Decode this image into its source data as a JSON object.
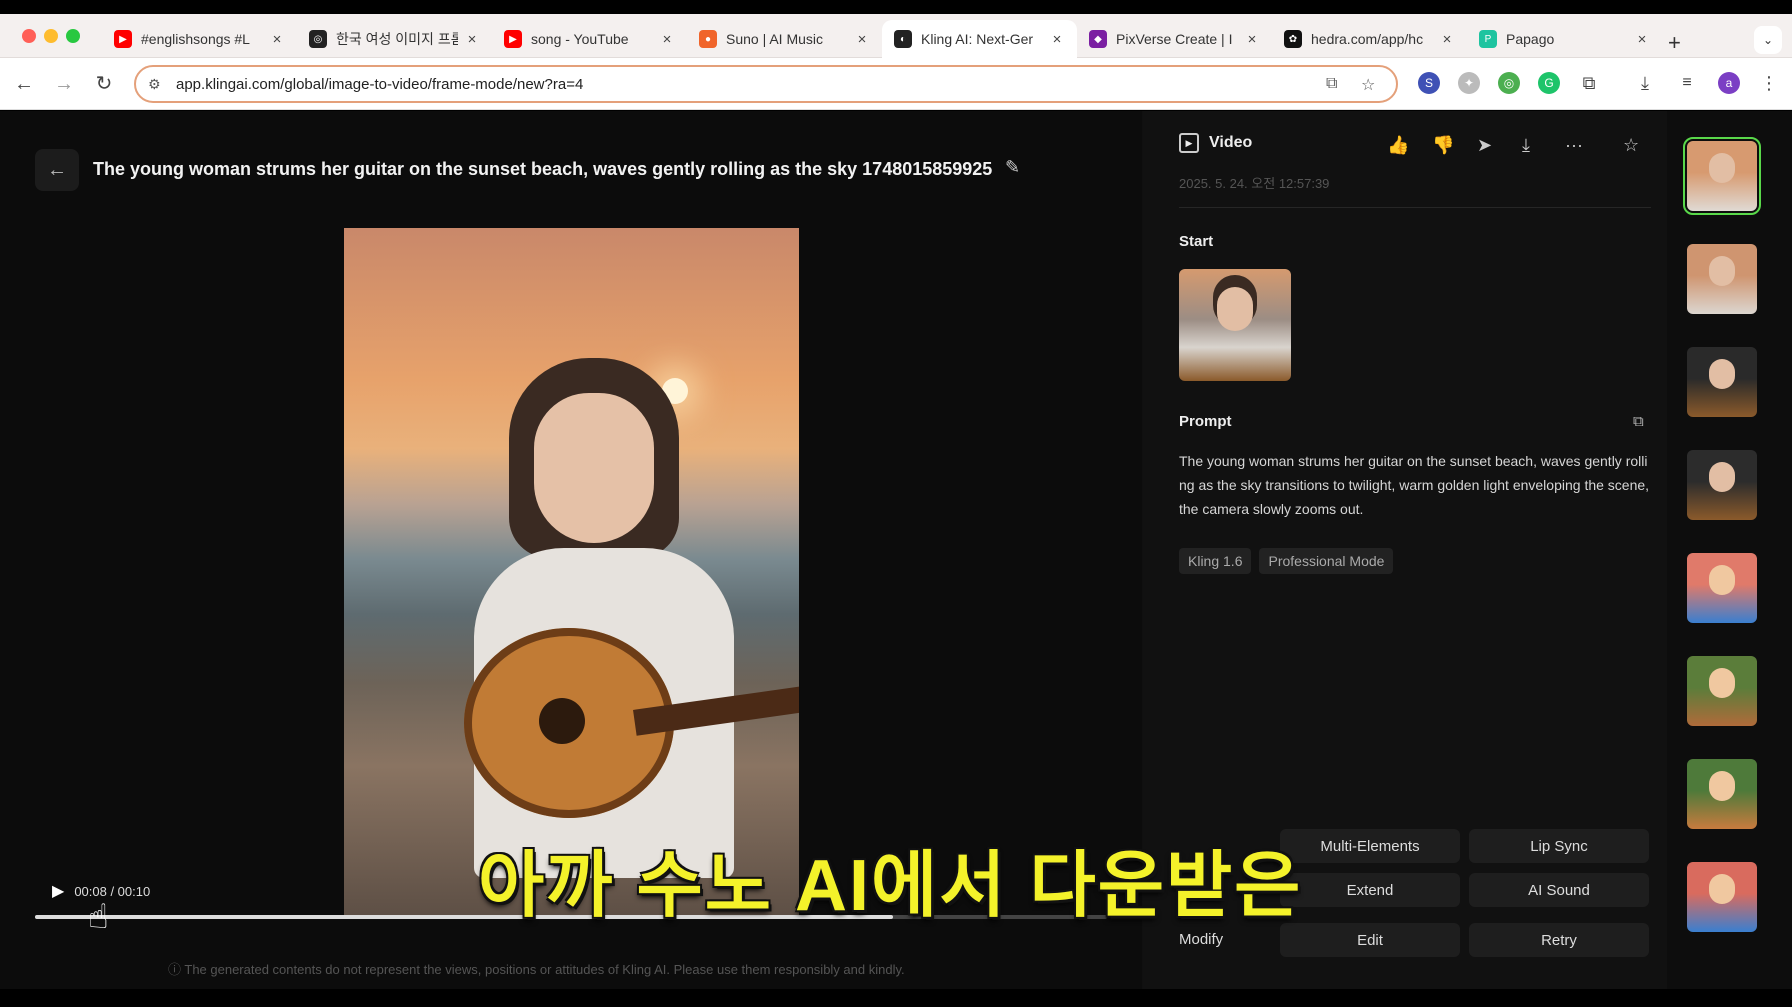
{
  "browser": {
    "tabs": [
      {
        "title": "#englishsongs #L",
        "fav_color": "#ff0000",
        "fav_glyph": "▶",
        "active": false
      },
      {
        "title": "한국 여성 이미지 프롬",
        "fav_color": "#222222",
        "fav_glyph": "◎",
        "active": false
      },
      {
        "title": "song - YouTube",
        "fav_color": "#ff0000",
        "fav_glyph": "▶",
        "active": false
      },
      {
        "title": "Suno | AI Music",
        "fav_color": "#f0642a",
        "fav_glyph": "●",
        "active": false
      },
      {
        "title": "Kling AI: Next-Ger",
        "fav_color": "#222222",
        "fav_glyph": "◐",
        "active": true
      },
      {
        "title": "PixVerse Create | I",
        "fav_color": "#7b1fa2",
        "fav_glyph": "◆",
        "active": false
      },
      {
        "title": "hedra.com/app/hc",
        "fav_color": "#111111",
        "fav_glyph": "✿",
        "active": false
      },
      {
        "title": "Papago",
        "fav_color": "#1ec4a0",
        "fav_glyph": "P",
        "active": false
      }
    ],
    "close_glyph": "×",
    "new_tab": "+",
    "tab_menu": "⌄",
    "url": "app.klingai.com/global/image-to-video/frame-mode/new?ra=4",
    "nav": {
      "back": "←",
      "forward": "→",
      "reload": "↻"
    },
    "omnibox_icons": {
      "tune": "⚙",
      "translate": "⧉",
      "star": "☆"
    },
    "profile_initial": "a"
  },
  "page": {
    "back_glyph": "←",
    "title": "The young woman strums her guitar on the sunset beach, waves gently rolling as the sky 1748015859925",
    "edit_glyph": "✎",
    "player": {
      "play_glyph": "▶",
      "time": "00:08 / 00:10",
      "progress": 0.8
    },
    "disclaimer": "ⓘ The generated contents do not represent the views, positions or attitudes of Kling AI. Please use them responsibly and kindly.",
    "subtitle": "아까 수노 AI에서 다운받은"
  },
  "panel": {
    "header": "Video",
    "date": "2025. 5. 24. 오전 12:57:39",
    "actions": [
      "👍",
      "👎",
      "➤",
      "⤓",
      "···",
      "☆"
    ],
    "start_label": "Start",
    "prompt_label": "Prompt",
    "copy_glyph": "⧉",
    "prompt": "The young woman strums her guitar on the sunset beach, waves gently rolling as the sky transitions to twilight, warm golden light enveloping the scene, the camera slowly zooms out.",
    "tags": [
      "Kling 1.6",
      "Professional Mode"
    ],
    "buttons": {
      "multi_elements": "Multi-Elements",
      "lip_sync": "Lip Sync",
      "extend": "Extend",
      "ai_sound": "AI Sound",
      "edit": "Edit",
      "retry": "Retry"
    },
    "modify_label": "Modify"
  },
  "rail": {
    "thumbs": [
      {
        "kind": "woman-guitar",
        "selected": true,
        "colors": [
          "#d79a70",
          "#e0dad4"
        ]
      },
      {
        "kind": "woman-guitar",
        "selected": false,
        "colors": [
          "#cf9570",
          "#dcd6d0"
        ]
      },
      {
        "kind": "woman-dark-guitar",
        "selected": false,
        "colors": [
          "#2a2a2a",
          "#8b5a2b"
        ]
      },
      {
        "kind": "woman-dark-guitar",
        "selected": false,
        "colors": [
          "#2c2c2c",
          "#8b5a2b"
        ]
      },
      {
        "kind": "cartoon-chopper",
        "selected": false,
        "colors": [
          "#e07a6a",
          "#3a7fd0"
        ]
      },
      {
        "kind": "cartoon-chopper",
        "selected": false,
        "colors": [
          "#5b7d3a",
          "#b06b3a"
        ]
      },
      {
        "kind": "cartoon-chopper",
        "selected": false,
        "colors": [
          "#4e7a3a",
          "#c87b3e"
        ]
      },
      {
        "kind": "cartoon-chopper",
        "selected": false,
        "colors": [
          "#d96b5e",
          "#3a7fd0"
        ]
      }
    ]
  }
}
